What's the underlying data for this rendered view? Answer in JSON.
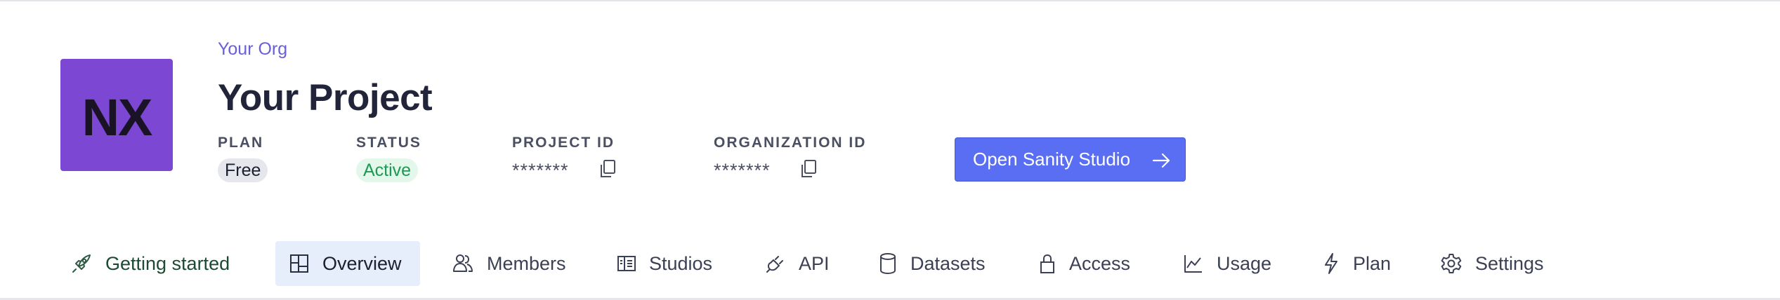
{
  "project": {
    "avatar_initials": "NX",
    "org_name": "Your Org",
    "title": "Your Project"
  },
  "meta": {
    "plan_label": "PLAN",
    "plan_value": "Free",
    "status_label": "STATUS",
    "status_value": "Active",
    "project_id_label": "PROJECT ID",
    "project_id_value": "*******",
    "organization_id_label": "ORGANIZATION ID",
    "organization_id_value": "*******"
  },
  "actions": {
    "open_studio_label": "Open Sanity Studio"
  },
  "tabs": [
    {
      "label": "Getting started",
      "icon": "rocket-icon"
    },
    {
      "label": "Overview",
      "icon": "dashboard-icon",
      "active": true
    },
    {
      "label": "Members",
      "icon": "users-icon"
    },
    {
      "label": "Studios",
      "icon": "studio-icon"
    },
    {
      "label": "API",
      "icon": "plug-icon"
    },
    {
      "label": "Datasets",
      "icon": "database-icon"
    },
    {
      "label": "Access",
      "icon": "lock-icon"
    },
    {
      "label": "Usage",
      "icon": "chart-icon"
    },
    {
      "label": "Plan",
      "icon": "bolt-icon"
    },
    {
      "label": "Settings",
      "icon": "gear-icon"
    }
  ],
  "colors": {
    "avatar": "#7b47d3",
    "primary_button": "#5a6ef3",
    "active_tab_bg": "#e6eefb",
    "status_green": "#1d9a52"
  }
}
